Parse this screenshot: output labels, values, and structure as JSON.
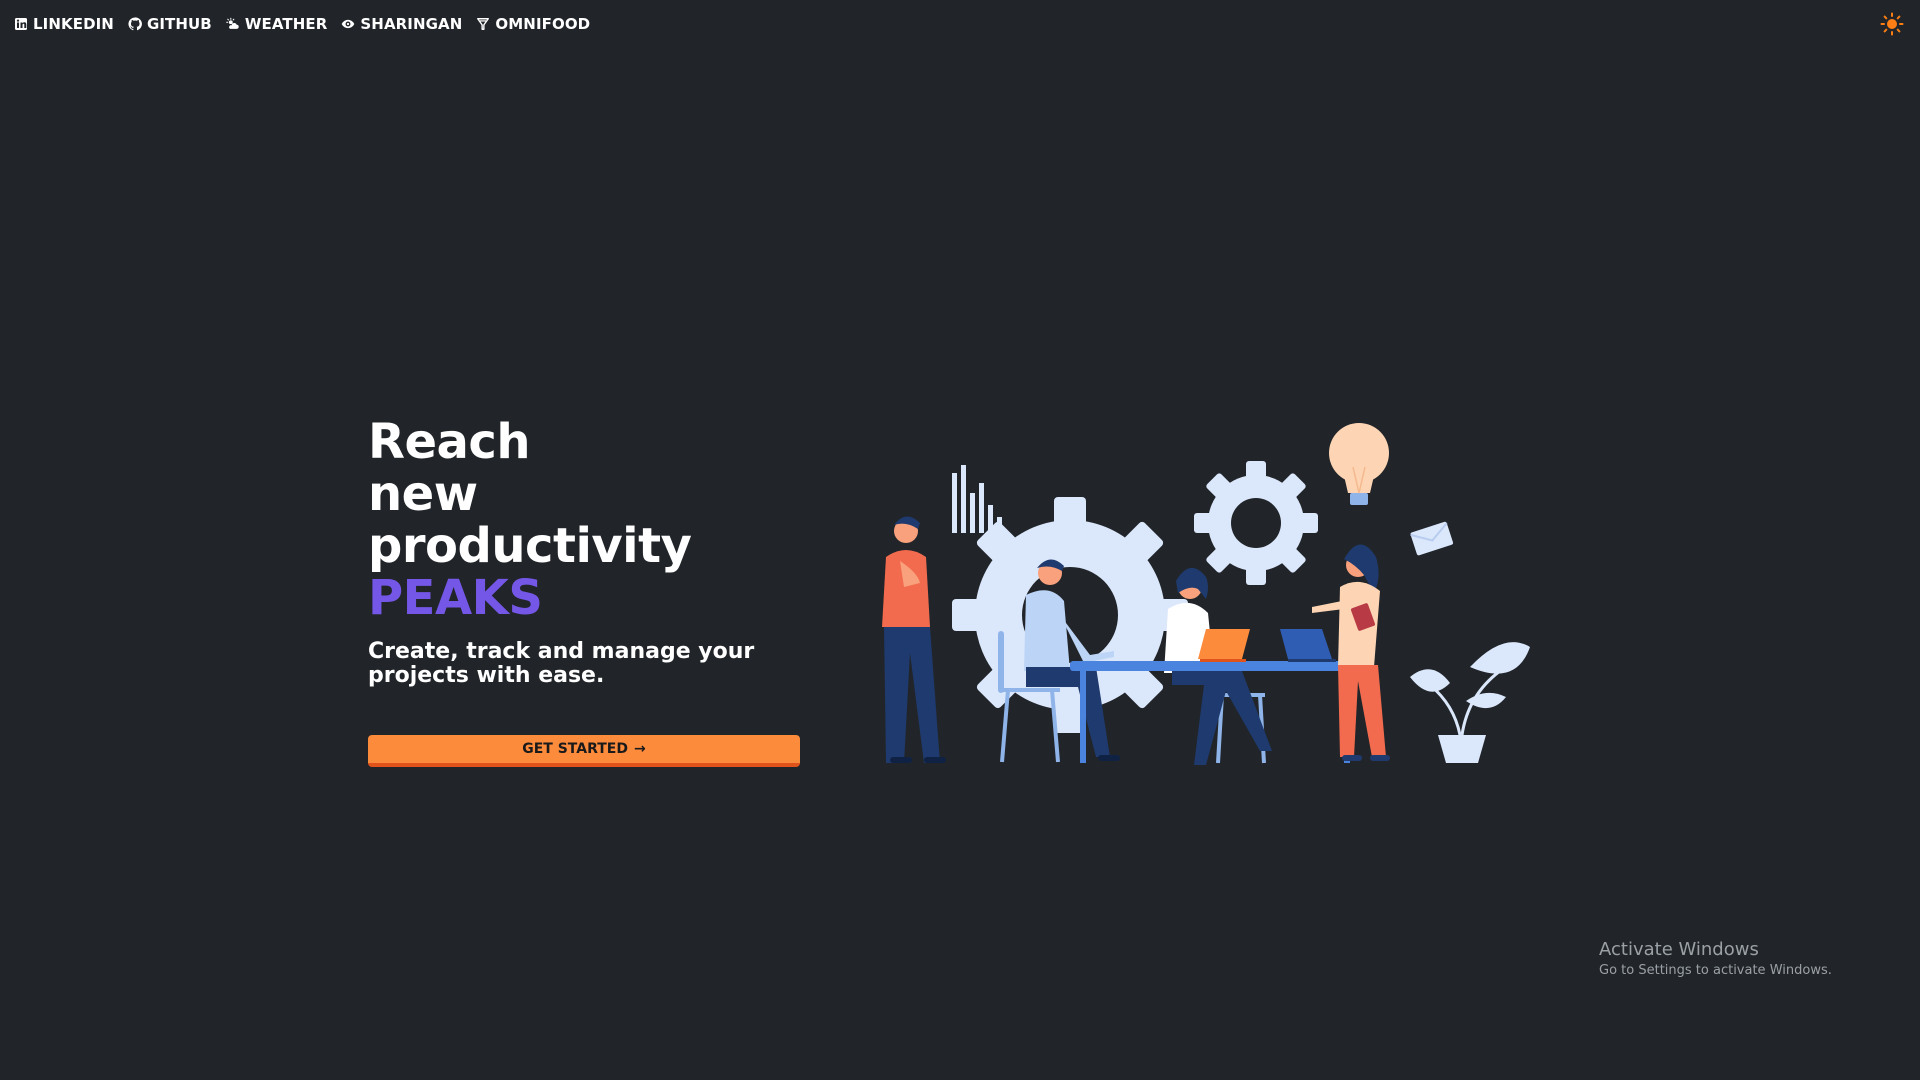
{
  "nav": {
    "links": [
      {
        "label": "LINKEDIN",
        "icon": "linkedin-icon"
      },
      {
        "label": "GITHUB",
        "icon": "github-icon"
      },
      {
        "label": "WEATHER",
        "icon": "weather-icon"
      },
      {
        "label": "SHARINGAN",
        "icon": "eye-icon"
      },
      {
        "label": "OMNIFOOD",
        "icon": "omnifood-icon"
      }
    ],
    "theme_toggle_icon": "sun-icon"
  },
  "hero": {
    "headline_lines": [
      "Reach",
      "new",
      "productivity"
    ],
    "headline_accent": "PEAKS",
    "subtitle": "Create, track and manage your projects with ease.",
    "cta_label": "GET STARTED",
    "cta_arrow": "→"
  },
  "watermark": {
    "title": "Activate Windows",
    "subtitle": "Go to Settings to activate Windows."
  },
  "colors": {
    "background": "#212529",
    "accent_purple": "#7557e8",
    "cta_orange": "#fd8b3c",
    "cta_border": "#e0531b",
    "sun_orange": "#fd7e14"
  }
}
